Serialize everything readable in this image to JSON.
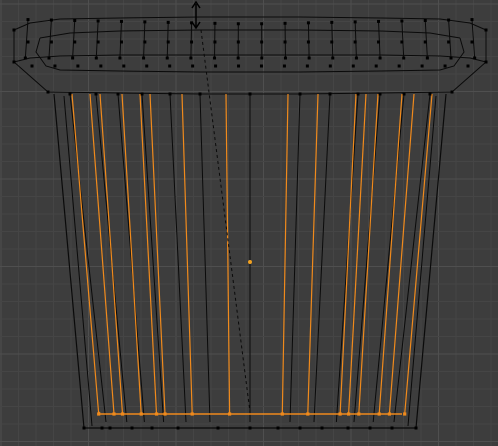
{
  "viewport": {
    "mode": "edit-mode",
    "background": "#3d3d3d",
    "grid_minor_color": "#454545",
    "grid_major_color": "#4f4f4f"
  },
  "mesh": {
    "edge_color": "#0a0a0a",
    "selected_color": "#f08a1c",
    "vertex_color": "#000000",
    "origin_color": "#f0a020"
  },
  "gizmo": {
    "icon": "transform-arrow-icon"
  }
}
